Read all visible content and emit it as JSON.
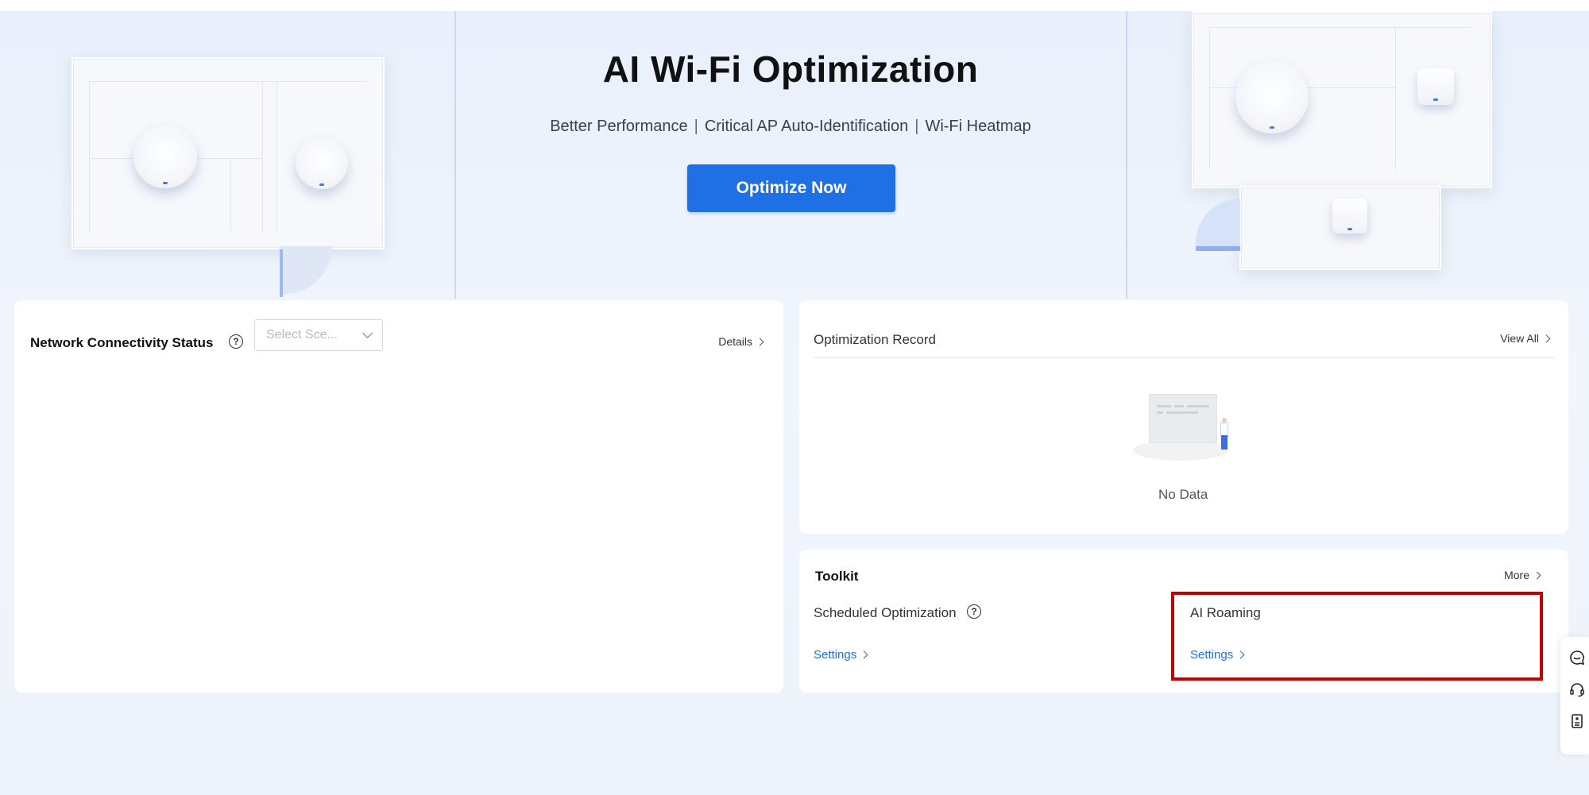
{
  "hero": {
    "title": "AI Wi-Fi Optimization",
    "features": [
      "Better Performance",
      "Critical AP Auto-Identification",
      "Wi-Fi Heatmap"
    ],
    "separator": "|",
    "optimize_label": "Optimize Now"
  },
  "network_status": {
    "title": "Network Connectivity Status",
    "scenario_select": {
      "value": "Select Sce..."
    },
    "details_label": "Details"
  },
  "optimization_record": {
    "title": "Optimization Record",
    "view_all_label": "View All",
    "empty_text": "No Data"
  },
  "toolkit": {
    "title": "Toolkit",
    "more_label": "More",
    "items": [
      {
        "label": "Scheduled Optimization",
        "settings_label": "Settings"
      },
      {
        "label": "AI Roaming",
        "settings_label": "Settings"
      }
    ]
  },
  "colors": {
    "accent": "#1f6fe5",
    "highlight": "#c00000"
  },
  "side_toolbar": {
    "icons": [
      "chat-icon",
      "headset-icon",
      "document-icon"
    ]
  }
}
